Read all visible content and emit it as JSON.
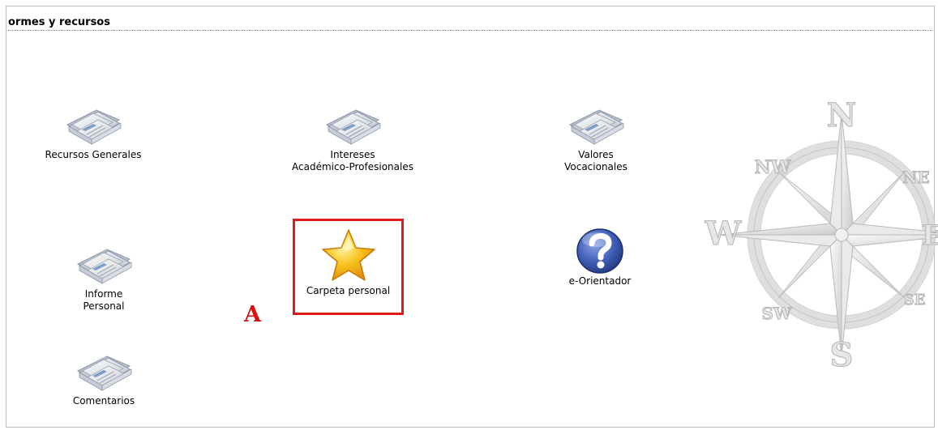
{
  "header": {
    "title": "ormes y recursos"
  },
  "items": [
    {
      "id": "recursos-generales",
      "lines": [
        "Recursos Generales"
      ],
      "icon": "documents-folder-icon"
    },
    {
      "id": "intereses",
      "lines": [
        "Intereses",
        "Académico-Profesionales"
      ],
      "icon": "documents-folder-icon"
    },
    {
      "id": "valores",
      "lines": [
        "Valores",
        "Vocacionales"
      ],
      "icon": "documents-folder-icon"
    },
    {
      "id": "informe-personal",
      "lines": [
        "Informe",
        "Personal"
      ],
      "icon": "documents-folder-icon"
    },
    {
      "id": "carpeta-personal",
      "lines": [
        "Carpeta personal"
      ],
      "icon": "star-icon"
    },
    {
      "id": "e-orientador",
      "lines": [
        "e-Orientador"
      ],
      "icon": "help-question-icon"
    },
    {
      "id": "comentarios",
      "lines": [
        "Comentarios"
      ],
      "icon": "documents-folder-icon"
    }
  ],
  "annotation": {
    "label": "A",
    "color": "#d41010"
  },
  "compass": {
    "labels": {
      "n": "N",
      "s": "S",
      "e": "E",
      "w": "W",
      "ne": "NE",
      "nw": "NW",
      "se": "SE",
      "sw": "SW"
    }
  },
  "colors": {
    "highlight": "#e01a1a",
    "header_rule": "#6a8ab8"
  }
}
